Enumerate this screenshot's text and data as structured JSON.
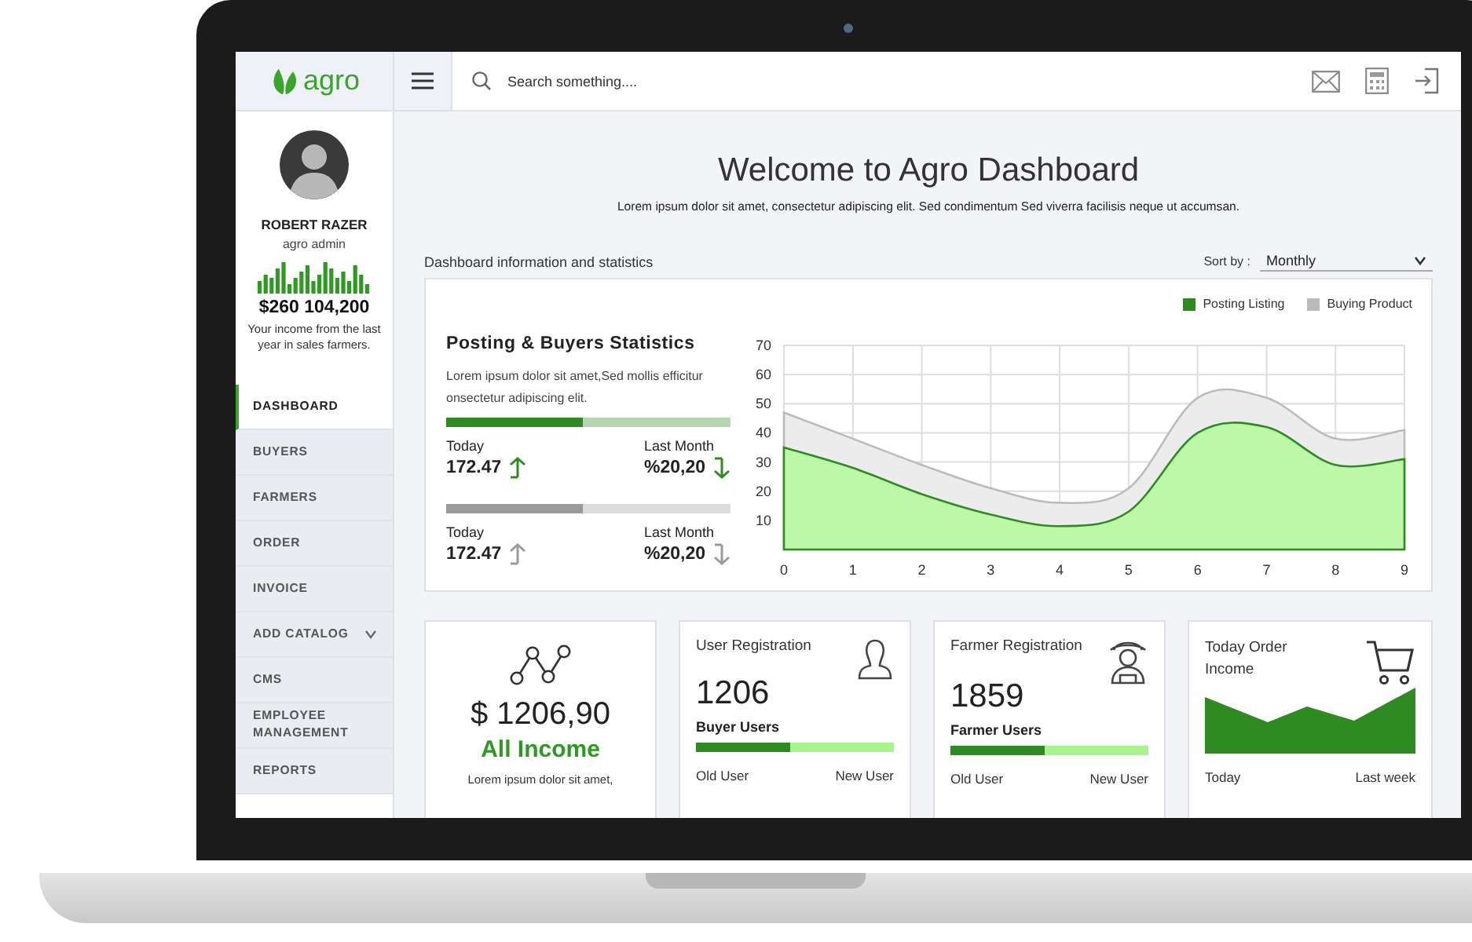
{
  "logo": {
    "text": "agro"
  },
  "search": {
    "placeholder": "Search something...."
  },
  "profile": {
    "name": "ROBERT RAZER",
    "role": "agro admin",
    "income": "$260 104,200",
    "note": "Your income from the last year in sales farmers."
  },
  "sidebar": {
    "items": [
      {
        "label": "DASHBOARD",
        "selected": true
      },
      {
        "label": "BUYERS",
        "selected": false
      },
      {
        "label": "FARMERS",
        "selected": false
      },
      {
        "label": "ORDER",
        "selected": false
      },
      {
        "label": "INVOICE",
        "selected": false
      },
      {
        "label": "ADD CATALOG",
        "selected": false,
        "expanded": false
      },
      {
        "label": "CMS",
        "selected": false
      },
      {
        "label": "EMPLOYEE MANAGEMENT",
        "selected": false
      },
      {
        "label": "REPORTS",
        "selected": false
      }
    ]
  },
  "header": {
    "title": "Welcome to Agro Dashboard",
    "subtitle": "Lorem ipsum dolor sit amet, consectetur adipiscing elit. Sed condimentum Sed viverra facilisis neque ut accumsan."
  },
  "section": {
    "label": "Dashboard information and statistics",
    "sort_label": "Sort by :",
    "sort_value": "Monthly"
  },
  "stats": {
    "title": "Posting & Buyers Statistics",
    "text": "Lorem ipsum dolor sit amet,Sed mollis efficitur onsectetur adipiscing elit.",
    "groups": [
      {
        "color": "#2e8b22",
        "level": 0.48,
        "items": [
          {
            "label": "Today",
            "value": "172.47",
            "kind": "up"
          },
          {
            "label": "Last Month",
            "value": "%20,20",
            "kind": "down"
          }
        ]
      },
      {
        "color": "#9a9a9a",
        "level": 0.48,
        "items": [
          {
            "label": "Today",
            "value": "172.47",
            "kind": "up"
          },
          {
            "label": "Last Month",
            "value": "%20,20",
            "kind": "down"
          }
        ]
      }
    ],
    "chart_data": {
      "type": "area",
      "x": [
        0,
        1,
        2,
        3,
        4,
        5,
        6,
        7,
        8,
        9
      ],
      "xlim": [
        0,
        9
      ],
      "grid": true,
      "xticks": [
        0,
        1,
        2,
        3,
        4,
        5,
        6,
        7,
        8,
        9
      ],
      "yticks": [
        10,
        20,
        30,
        40,
        50,
        60,
        70
      ],
      "ylim": [
        0,
        70
      ],
      "stacked": false,
      "series": [
        {
          "name": "Posting Listing",
          "color": "#2e8b22",
          "values": [
            35,
            28,
            19,
            12,
            8,
            13,
            40,
            42,
            29,
            31
          ]
        },
        {
          "name": "Buying Product",
          "color": "#bbbbbb",
          "values": [
            47,
            38,
            29,
            21,
            16,
            21,
            52,
            52,
            38,
            41
          ]
        }
      ]
    }
  },
  "cards": [
    {
      "kind": "income",
      "value": "$ 1206,90",
      "label": "All Income",
      "text": "Lorem ipsum dolor sit amet,"
    },
    {
      "kind": "user_registration",
      "title": "User Registration",
      "value": "1206",
      "label": "Buyer Users",
      "level": 0.48,
      "columns": [
        "Old User",
        "New User"
      ]
    },
    {
      "kind": "farmer_registration",
      "title": "Farmer Registration",
      "value": "1859",
      "label": "Farmer Users",
      "level": 0.48,
      "columns": [
        "Old User",
        "New User"
      ]
    },
    {
      "kind": "order",
      "title": "Today Order Income",
      "columns": [
        "Today",
        "Last week"
      ]
    }
  ]
}
